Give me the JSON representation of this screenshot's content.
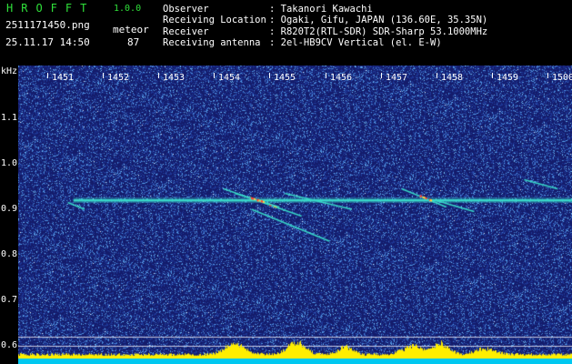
{
  "header": {
    "app_name": "HROFFT",
    "app_version": "1.0.0",
    "filename": "2511171450.png",
    "timestamp": "25.11.17 14:50",
    "meteor_label": "meteor",
    "meteor_count": "87"
  },
  "info": [
    {
      "label": "Observer",
      "value": ": Takanori Kawachi"
    },
    {
      "label": "Receiving Location",
      "value": ": Ogaki, Gifu, JAPAN (136.60E, 35.35N)"
    },
    {
      "label": "Receiver",
      "value": ": R820T2(RTL-SDR) SDR-Sharp 53.1000MHz"
    },
    {
      "label": "Receiving antenna",
      "value": ": 2el-HB9CV Vertical (el. E-W)"
    }
  ],
  "axes": {
    "y_unit": "kHz",
    "y_ticks": [
      "1.1",
      "1.0",
      "0.9",
      "0.8",
      "0.7",
      "0.6"
    ],
    "x_ticks": [
      "1451",
      "1452",
      "1453",
      "1454",
      "1455",
      "1456",
      "1457",
      "1458",
      "1459",
      "1500"
    ]
  },
  "colors": {
    "background": "#141c6b",
    "noise": "#4e8fe0",
    "carrier": "#38d8c8",
    "echo_hot": "#ff4030",
    "band_yellow": "#ffee00",
    "band_cyan": "#00c8f0",
    "app_green": "#2fe03a"
  },
  "chart_data": {
    "type": "heatmap",
    "title": "",
    "xlabel": "",
    "ylabel": "kHz",
    "x_ticks": [
      "1451",
      "1452",
      "1453",
      "1454",
      "1455",
      "1456",
      "1457",
      "1458",
      "1459",
      "1500"
    ],
    "ylim": [
      0.57,
      1.2
    ],
    "y_ticks": [
      1.1,
      1.0,
      0.9,
      0.8,
      0.7,
      0.6
    ],
    "carrier_khz": 0.92,
    "reference_lines_khz": [
      0.62,
      0.6
    ],
    "echoes": [
      {
        "t0": 1453.9,
        "t1": 1455.3,
        "f0": 0.945,
        "f1": 0.885,
        "hot": true
      },
      {
        "t0": 1454.1,
        "t1": 1454.9,
        "f0": 0.935,
        "f1": 0.905,
        "hot": true
      },
      {
        "t0": 1454.4,
        "t1": 1455.8,
        "f0": 0.9,
        "f1": 0.83,
        "hot": false
      },
      {
        "t0": 1455.0,
        "t1": 1456.2,
        "f0": 0.935,
        "f1": 0.9,
        "hot": false
      },
      {
        "t0": 1457.1,
        "t1": 1457.9,
        "f0": 0.945,
        "f1": 0.905,
        "hot": true
      },
      {
        "t0": 1457.7,
        "t1": 1458.4,
        "f0": 0.92,
        "f1": 0.895,
        "hot": false
      },
      {
        "t0": 1459.3,
        "t1": 1459.9,
        "f0": 0.965,
        "f1": 0.945,
        "hot": false
      },
      {
        "t0": 1451.1,
        "t1": 1451.4,
        "f0": 0.915,
        "f1": 0.9,
        "hot": false
      }
    ]
  }
}
